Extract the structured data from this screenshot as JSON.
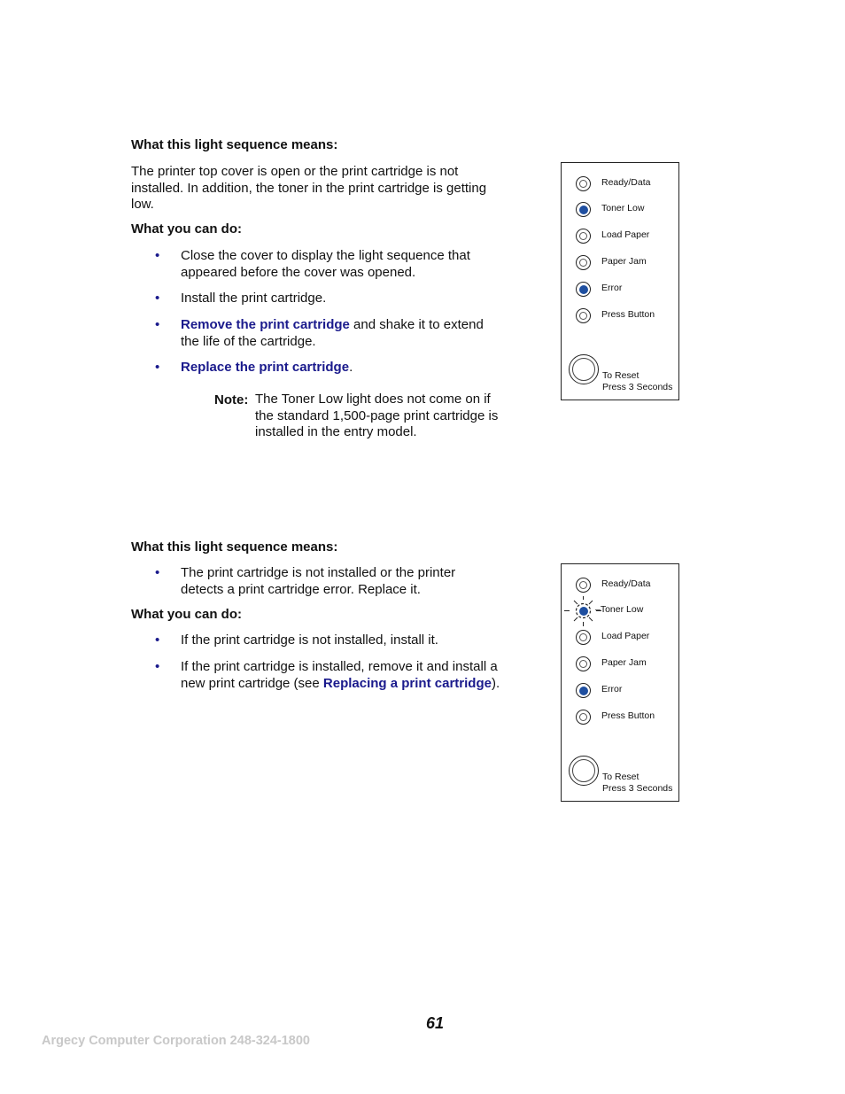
{
  "sections": [
    {
      "means_heading": "What this light sequence means:",
      "means_text": "The printer top cover is open or the print cartridge is not installed. In addition, the toner in the print cartridge is getting low.",
      "do_heading": "What you can do:",
      "actions": [
        {
          "text": "Close the cover to display the light sequence that appeared before the cover was opened."
        },
        {
          "text": "Install the print cartridge."
        },
        {
          "link": "Remove the print cartridge",
          "text": " and shake it to extend the life of the cartridge."
        },
        {
          "link": "Replace the print cartridge",
          "text": "."
        }
      ],
      "note_label": "Note:",
      "note_text": "The Toner Low light does not come on if the standard 1,500-page print cartridge is installed in the entry model.",
      "panel": {
        "lights": [
          {
            "label": "Ready/Data",
            "state": "off"
          },
          {
            "label": "Toner  Low",
            "state": "on"
          },
          {
            "label": "Load Paper",
            "state": "off"
          },
          {
            "label": "Paper Jam",
            "state": "off"
          },
          {
            "label": "Error",
            "state": "on"
          },
          {
            "label": "Press Button",
            "state": "off"
          }
        ],
        "reset_line1": "To Reset",
        "reset_line2": "Press 3 Seconds"
      }
    },
    {
      "means_heading": "What this light sequence means:",
      "means_bullet": "The print cartridge is not installed or the printer detects a print cartridge error. Replace it.",
      "do_heading": "What you can do:",
      "actions": [
        {
          "text": "If the print cartridge is not installed, install it."
        },
        {
          "text": "If the print cartridge is installed, remove it and install a new print cartridge (see ",
          "link": "Replacing a print cartridge",
          "after": ")."
        }
      ],
      "panel": {
        "lights": [
          {
            "label": "Ready/Data",
            "state": "off"
          },
          {
            "label": "Toner Low",
            "state": "blinking"
          },
          {
            "label": "Load Paper",
            "state": "off"
          },
          {
            "label": "Paper Jam",
            "state": "off"
          },
          {
            "label": "Error",
            "state": "on"
          },
          {
            "label": "Press Button",
            "state": "off"
          }
        ],
        "reset_line1": "To Reset",
        "reset_line2": "Press 3 Seconds"
      }
    }
  ],
  "bullet_glyph": "•",
  "page_number": "61",
  "footer": "Argecy Computer Corporation 248-324-1800",
  "colors": {
    "link": "#1a1a8c",
    "led_on": "#1f4fa0",
    "footer": "#c8c8c8"
  }
}
